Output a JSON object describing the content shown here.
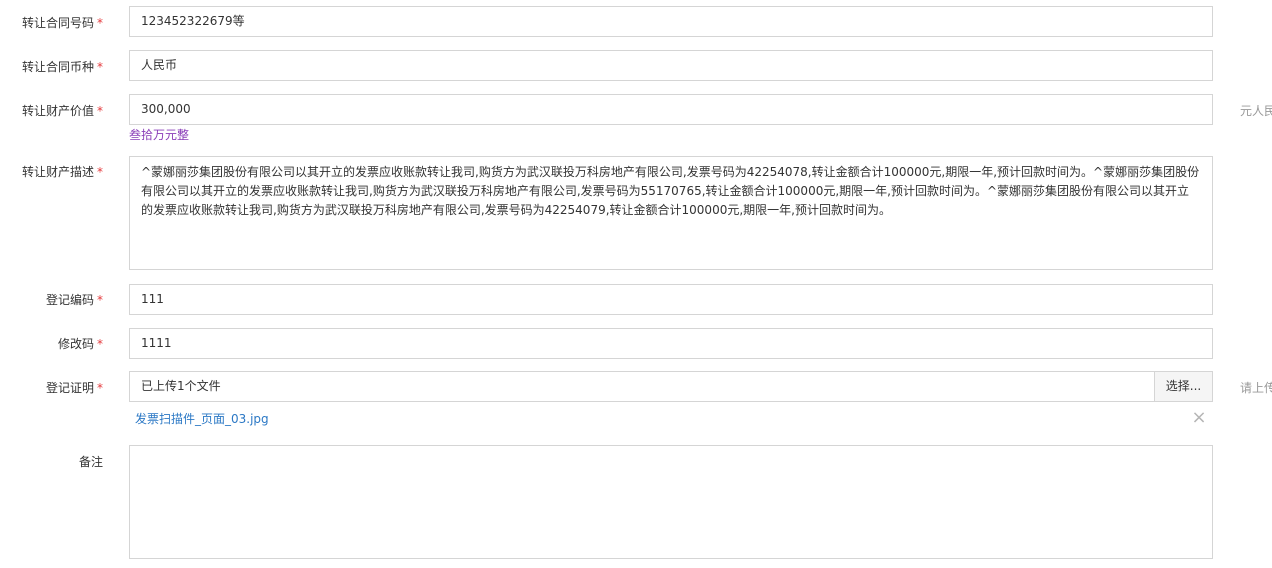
{
  "form": {
    "contract_no": {
      "label": "转让合同号码",
      "required_mark": "*",
      "value": "123452322679等"
    },
    "currency": {
      "label": "转让合同币种",
      "required_mark": "*",
      "value": "人民币"
    },
    "asset_value": {
      "label": "转让财产价值",
      "required_mark": "*",
      "value": "300,000",
      "uppercase_hint": "叁拾万元整",
      "unit_suffix": "元人民"
    },
    "asset_description": {
      "label": "转让财产描述",
      "required_mark": "*",
      "value": "^蒙娜丽莎集团股份有限公司以其开立的发票应收账款转让我司,购货方为武汉联投万科房地产有限公司,发票号码为42254078,转让金额合计100000元,期限一年,预计回款时间为。^蒙娜丽莎集团股份有限公司以其开立的发票应收账款转让我司,购货方为武汉联投万科房地产有限公司,发票号码为55170765,转让金额合计100000元,期限一年,预计回款时间为。^蒙娜丽莎集团股份有限公司以其开立的发票应收账款转让我司,购货方为武汉联投万科房地产有限公司,发票号码为42254079,转让金额合计100000元,期限一年,预计回款时间为。"
    },
    "registration_no": {
      "label": "登记编码",
      "required_mark": "*",
      "value": "111"
    },
    "modify_code": {
      "label": "修改码",
      "required_mark": "*",
      "value": "1111"
    },
    "registration_proof": {
      "label": "登记证明",
      "required_mark": "*",
      "status_text": "已上传1个文件",
      "choose_button": "选择...",
      "side_hint": "请上传",
      "files": [
        {
          "name": "发票扫描件_页面_03.jpg",
          "remove_icon": "close-icon"
        }
      ]
    },
    "remarks": {
      "label": "备注",
      "value": ""
    }
  }
}
